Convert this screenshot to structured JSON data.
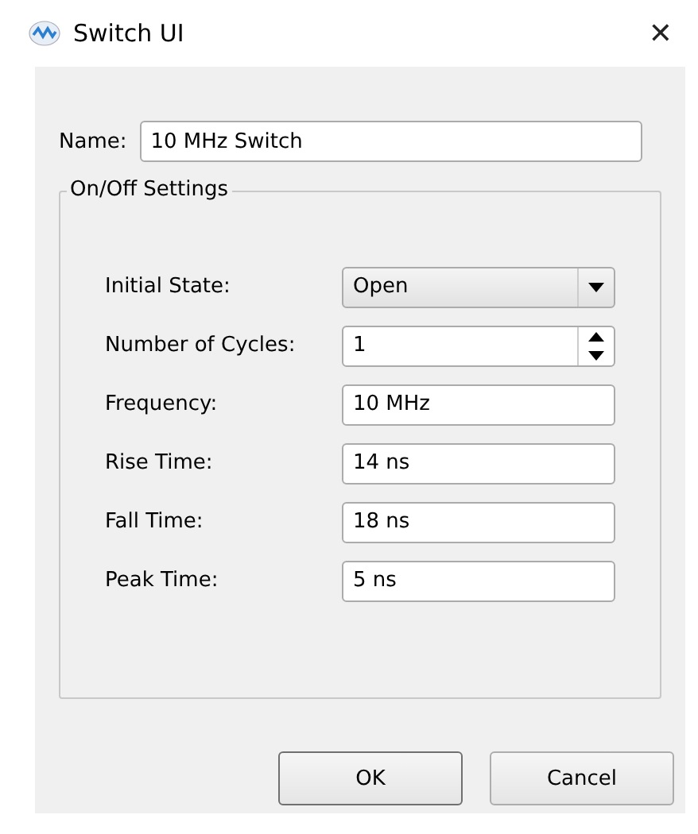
{
  "window": {
    "title": "Switch UI",
    "close": "✕"
  },
  "name_field": {
    "label": "Name:",
    "value": "10 MHz Switch"
  },
  "group": {
    "title": "On/Off Settings",
    "rows": [
      {
        "kind": "combo",
        "label": "Initial State:",
        "value": "Open"
      },
      {
        "kind": "spin",
        "label": "Number of Cycles:",
        "value": "1"
      },
      {
        "kind": "text",
        "label": "Frequency:",
        "value": "10 MHz"
      },
      {
        "kind": "text",
        "label": "Rise Time:",
        "value": "14 ns"
      },
      {
        "kind": "text",
        "label": "Fall Time:",
        "value": "18 ns"
      },
      {
        "kind": "text",
        "label": "Peak Time:",
        "value": "5 ns"
      }
    ]
  },
  "buttons": [
    {
      "label": "OK",
      "default": true
    },
    {
      "label": "Cancel",
      "default": false
    }
  ]
}
